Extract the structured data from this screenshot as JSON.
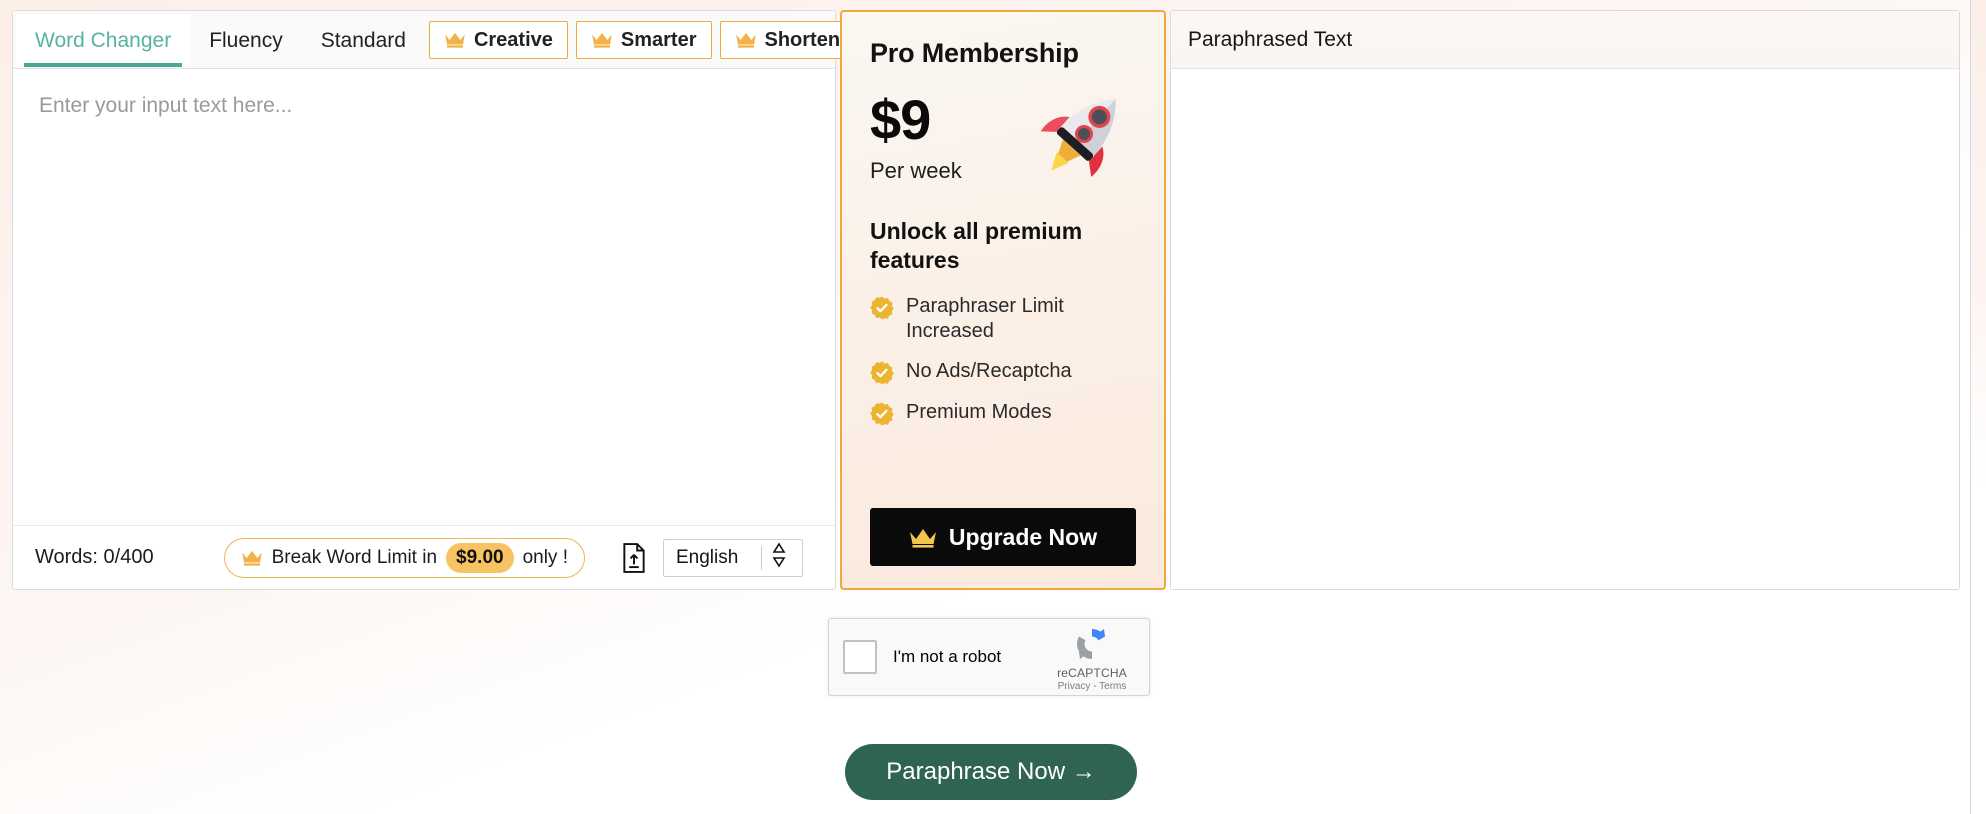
{
  "theme": {
    "accent_teal": "#4aa794",
    "accent_orange": "#eda93c",
    "chip_orange": "#f8c463",
    "button_green": "#2f6451",
    "button_black": "#0a0a0a",
    "page_bg": "#fdf3ef"
  },
  "editor": {
    "tabs": [
      {
        "label": "Word Changer",
        "active": true,
        "pro": false
      },
      {
        "label": "Fluency",
        "active": false,
        "pro": false
      },
      {
        "label": "Standard",
        "active": false,
        "pro": false
      },
      {
        "label": "Creative",
        "active": false,
        "pro": true
      },
      {
        "label": "Smarter",
        "active": false,
        "pro": true
      },
      {
        "label": "Shorten",
        "active": false,
        "pro": true
      }
    ],
    "input_placeholder": "Enter your input text here...",
    "input_value": "",
    "footer": {
      "words_label": "Words: 0/400",
      "limit_pill_prefix": "Break Word Limit in",
      "limit_pill_price": "$9.00",
      "limit_pill_suffix": "only !",
      "upload_icon": "file-upload-icon",
      "language_value": "English",
      "language_caret": "up-down-chevron-icon"
    }
  },
  "promo": {
    "title": "Pro Membership",
    "price": "$9",
    "period": "Per week",
    "rocket_icon": "rocket-icon",
    "unlock_heading": "Unlock all premium features",
    "features": [
      "Paraphraser Limit Increased",
      "No Ads/Recaptcha",
      "Premium Modes"
    ],
    "upgrade_label": "Upgrade Now",
    "upgrade_icon": "crown-icon"
  },
  "output": {
    "title": "Paraphrased Text",
    "body": ""
  },
  "captcha": {
    "label": "I'm not a robot",
    "brand": "reCAPTCHA",
    "links": "Privacy - Terms",
    "logo_icon": "recaptcha-logo-icon",
    "checked": false
  },
  "actions": {
    "paraphrase_label": "Paraphrase Now  →"
  }
}
